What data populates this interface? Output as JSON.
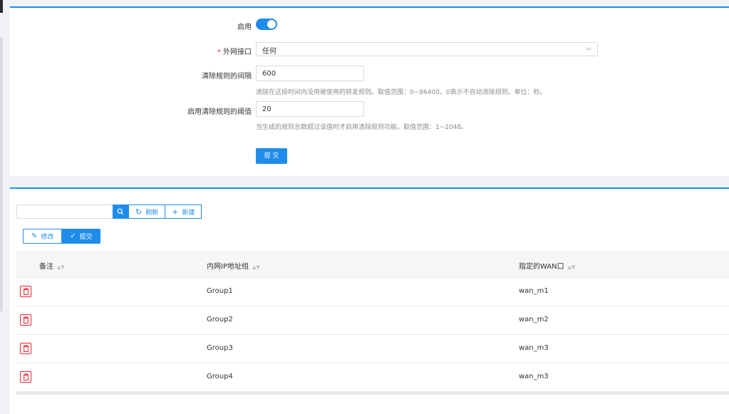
{
  "form": {
    "enable_label": "启用",
    "enable_on": true,
    "wan_label": "外网接口",
    "wan_required_mark": "*",
    "wan_value": "任何",
    "clear_interval_label": "清除规则的间隔",
    "clear_interval_value": "600",
    "clear_interval_hint": "清除在这段时间内没用被使用的转发规则。取值范围：0~86400。0表示不自动清除规则。单位：秒。",
    "threshold_label": "启用清除规则的阈值",
    "threshold_value": "20",
    "threshold_hint": "当生成的规则总数超过该值时才启用清除规则功能。取值范围：1~2048。",
    "submit_label": "提 交"
  },
  "toolbar": {
    "search_value": "",
    "refresh_label": "刷新",
    "new_label": "新建",
    "edit_label": "修改",
    "submit_label": "提交"
  },
  "table": {
    "columns": [
      "备注",
      "内网IP地址组",
      "指定的WAN口"
    ],
    "rows": [
      {
        "remark": "",
        "group": "Group1",
        "wan": "wan_m1"
      },
      {
        "remark": "",
        "group": "Group2",
        "wan": "wan_m2"
      },
      {
        "remark": "",
        "group": "Group3",
        "wan": "wan_m3"
      },
      {
        "remark": "",
        "group": "Group4",
        "wan": "wan_m3"
      }
    ]
  },
  "colors": {
    "primary": "#1f8ceb",
    "danger": "#f5222d"
  }
}
